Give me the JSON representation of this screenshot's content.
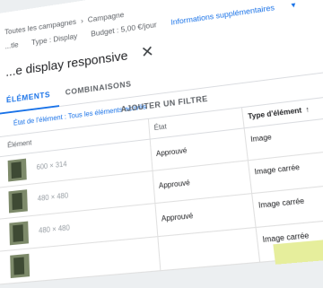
{
  "header": {
    "breadcrumb": [
      "Toutes les campagnes",
      "Campagne"
    ],
    "meta": {
      "location": "...tle",
      "type_label": "Type : Display",
      "budget_label": "Budget : 5,00 €/jour",
      "more_info_label": "Informations supplémentaires"
    }
  },
  "page": {
    "title": "...e display responsive",
    "close_icon": "close-icon"
  },
  "tabs": [
    {
      "label": "ÉLÉMENTS",
      "active": true
    },
    {
      "label": "COMBINAISONS",
      "active": false
    }
  ],
  "filters": {
    "active_filter": "État de l'élément : Tous les éléments activés",
    "add_filter_label": "AJOUTER UN FILTRE"
  },
  "table": {
    "columns": [
      "Élément",
      "État",
      "Type d'élément"
    ],
    "sorted_column": "Type d'élément",
    "rows": [
      {
        "dims": "600 × 314",
        "state": "Approuvé",
        "type": "Image"
      },
      {
        "dims": "480 × 480",
        "state": "Approuvé",
        "type": "Image carrée"
      },
      {
        "dims": "480 × 480",
        "state": "Approuvé",
        "type": "Image carrée"
      },
      {
        "dims": "",
        "state": "",
        "type": "Image carrée"
      }
    ]
  },
  "colors": {
    "accent": "#1a73e8",
    "text": "#202124",
    "muted": "#5f6368"
  }
}
